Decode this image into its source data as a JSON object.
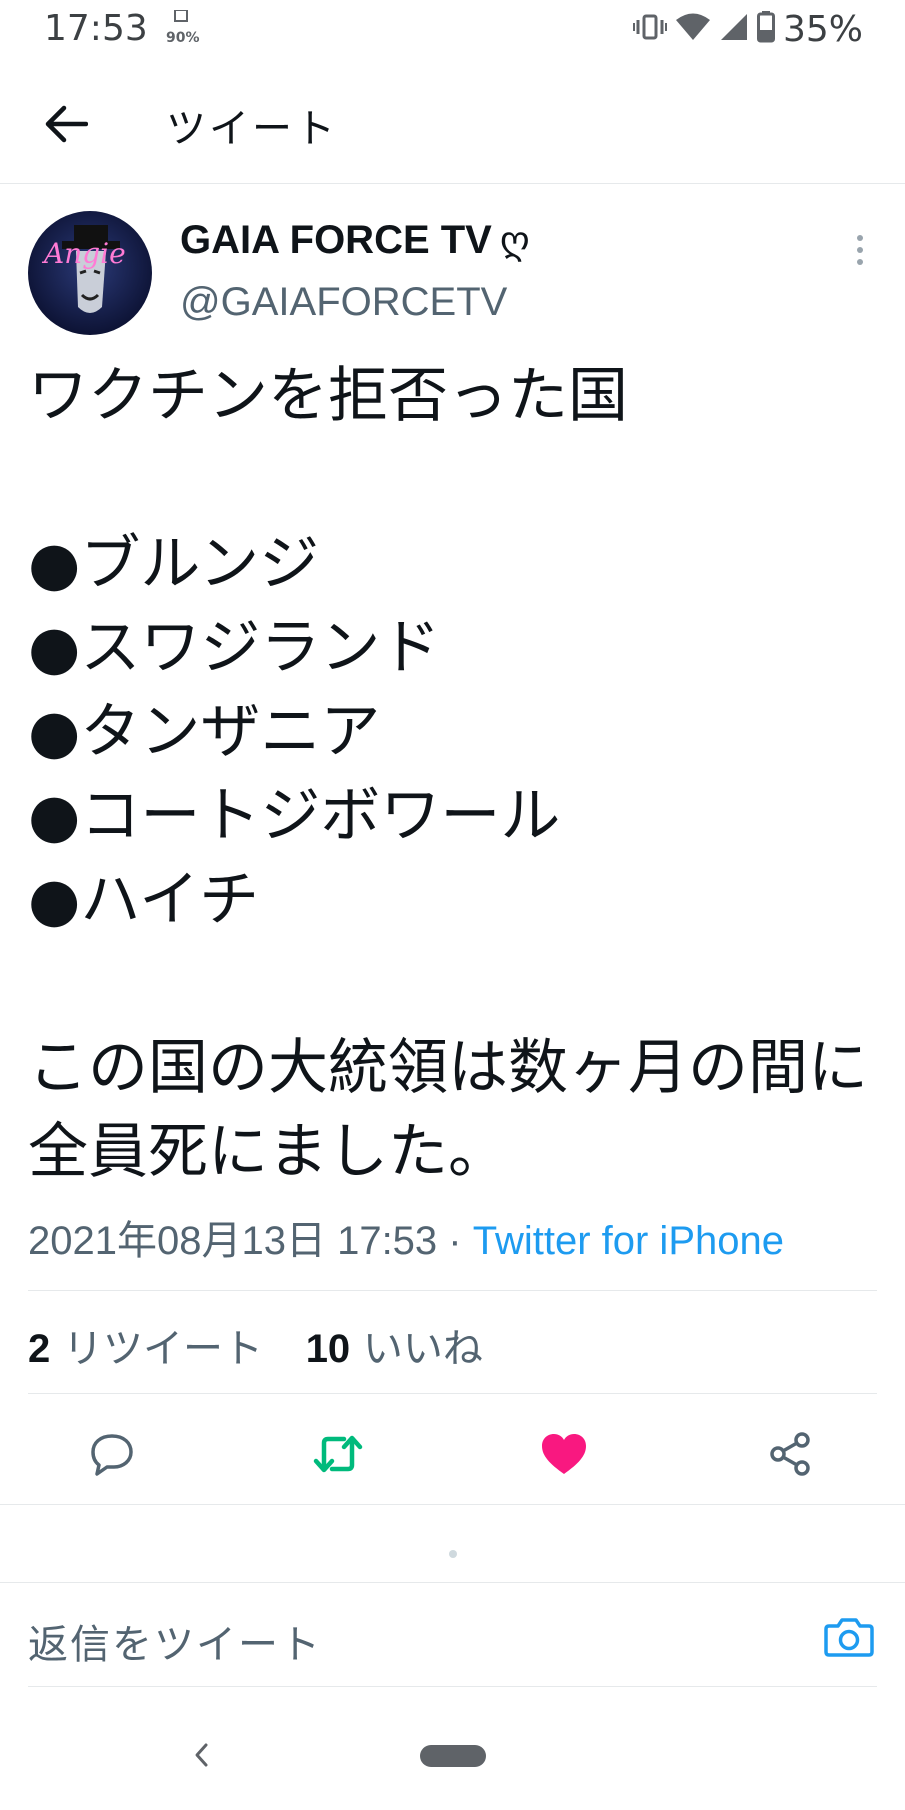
{
  "status_bar": {
    "time": "17:53",
    "mini_icon_text": "90%",
    "battery": "35%",
    "icons": [
      "vibrate-icon",
      "wifi-icon",
      "signal-icon",
      "battery-icon"
    ]
  },
  "header": {
    "title": "ツイート",
    "back_icon": "arrow-left-icon"
  },
  "tweet": {
    "author": {
      "name": "GAIA FORCE TV",
      "name_glyph": "ღ",
      "handle": "@GAIAFORCETV",
      "avatar_text": "Angie"
    },
    "text_lines": [
      "ワクチンを拒否った国",
      "●ブルンジ",
      "●スワジランド",
      "●タンザニア",
      "●コートジボワール",
      "●ハイチ",
      "この国の大統領は数ヶ月の間に全員死にました。"
    ],
    "timestamp": "2021年08月13日 17:53",
    "separator": " · ",
    "source": "Twitter for iPhone",
    "retweets_count": "2",
    "retweets_label": "リツイート",
    "likes_count": "10",
    "likes_label": "いいね"
  },
  "actions": {
    "reply_icon": "reply-icon",
    "retweet_icon": "retweet-icon",
    "like_icon": "heart-icon",
    "share_icon": "share-icon",
    "retweet_color": "#00ba7c",
    "like_color": "#f91880"
  },
  "reply_bar": {
    "placeholder": "返信をツイート",
    "camera_icon": "camera-icon",
    "accent": "#1d9bf0"
  },
  "nav_bar": {
    "back_icon": "chevron-left-icon",
    "home_icon": "home-pill-icon"
  }
}
